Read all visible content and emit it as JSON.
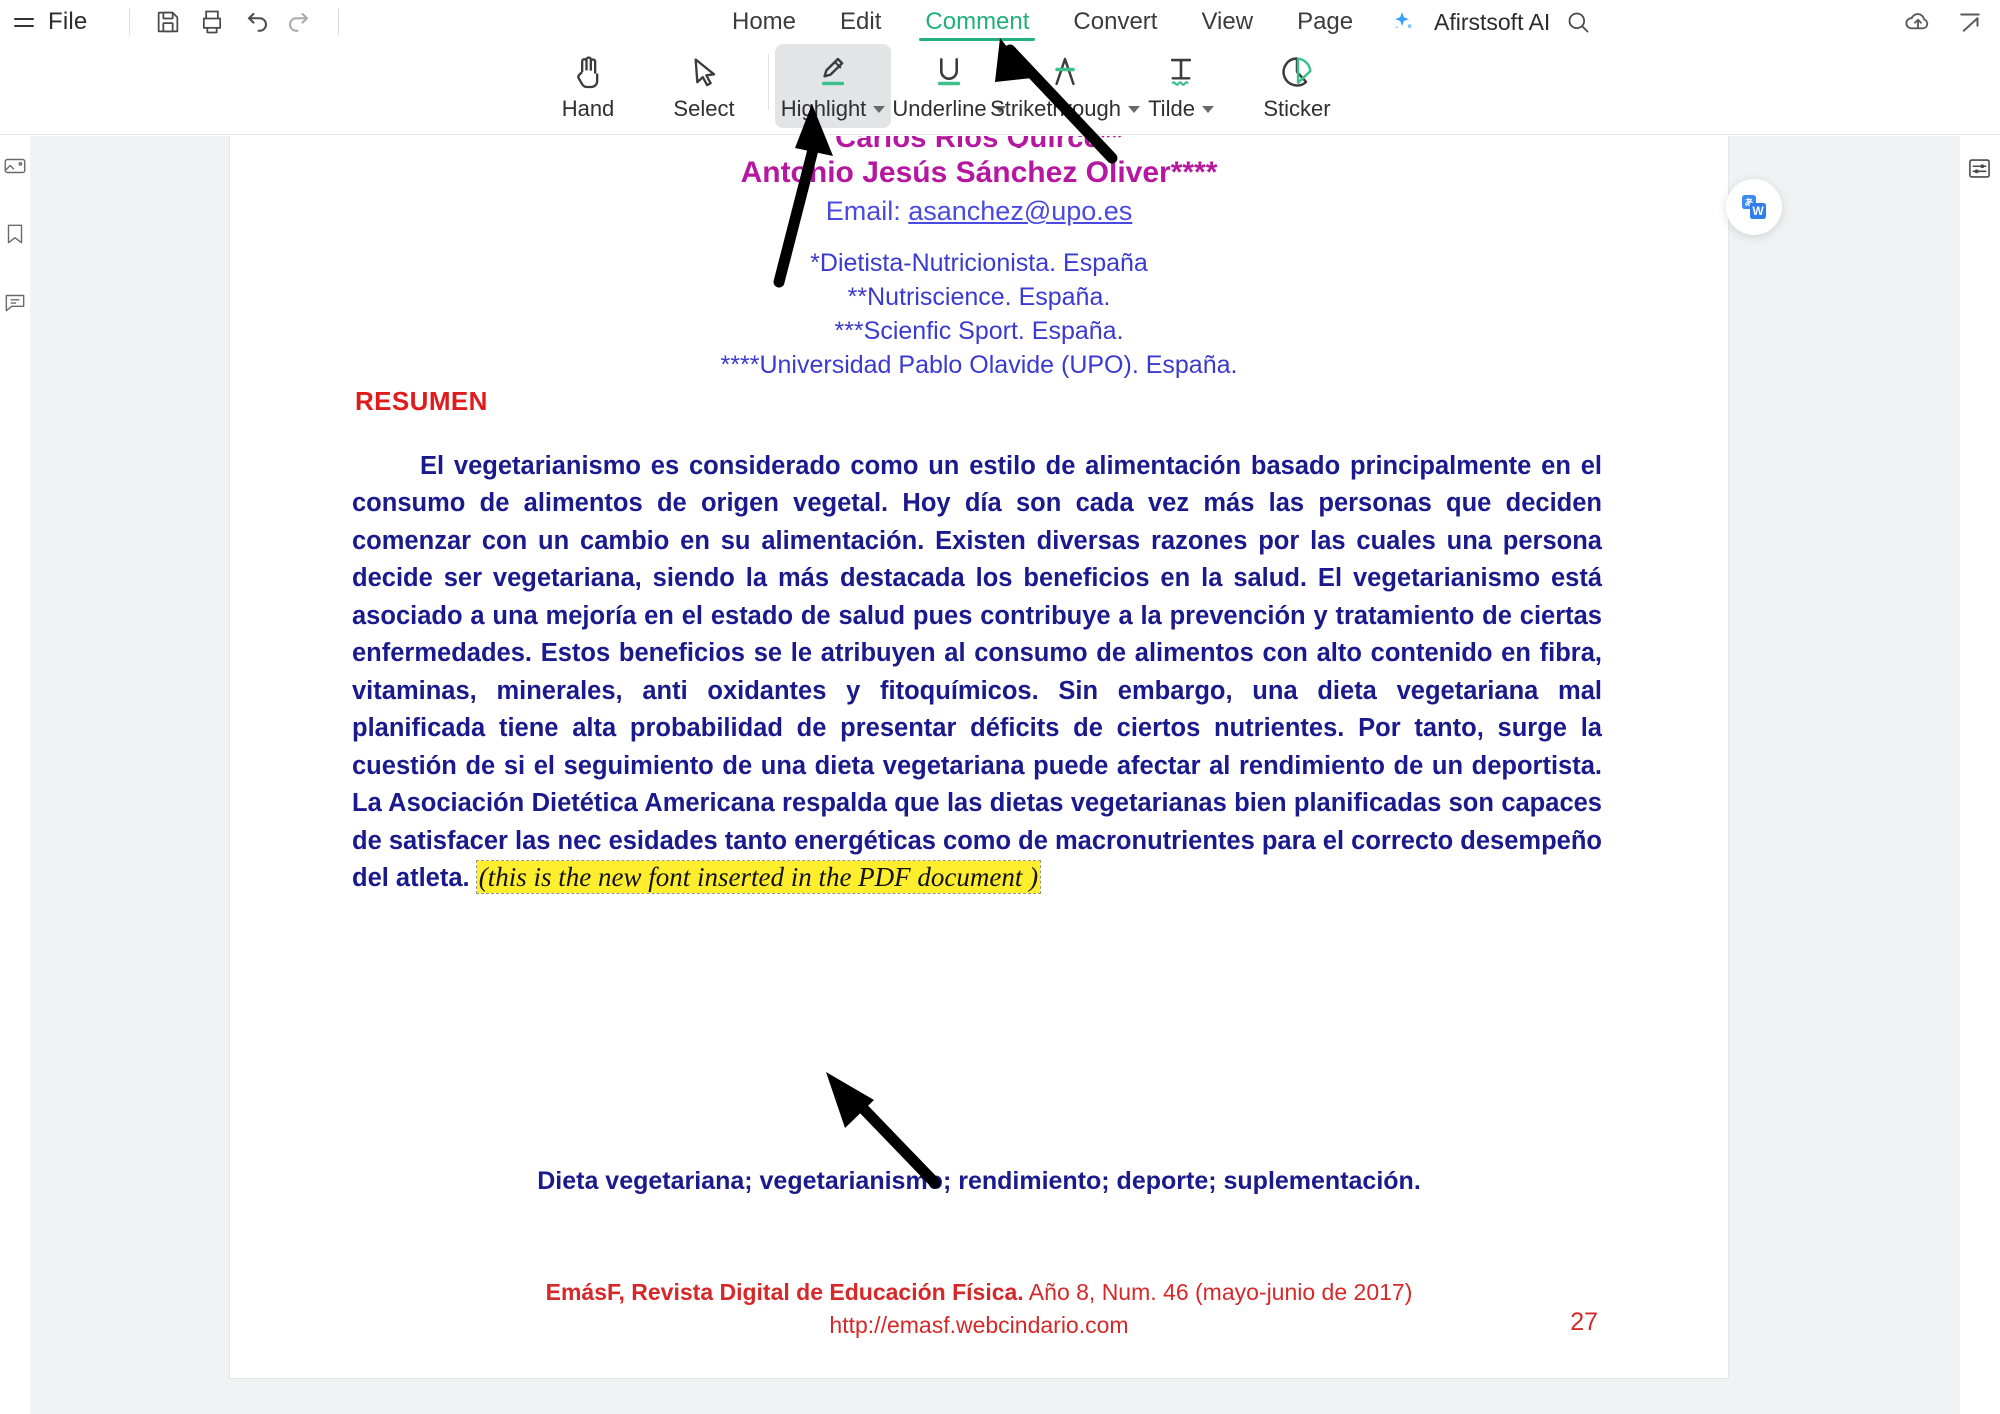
{
  "app": {
    "menu": {
      "file_label": "File",
      "hamburger_icon": "hamburger-menu-icon",
      "save_icon": "save-icon",
      "print_icon": "print-icon",
      "undo_icon": "undo-icon",
      "redo_icon": "redo-icon",
      "tabs": [
        {
          "label": "Home",
          "active": false
        },
        {
          "label": "Edit",
          "active": false
        },
        {
          "label": "Comment",
          "active": true
        },
        {
          "label": "Convert",
          "active": false
        },
        {
          "label": "View",
          "active": false
        },
        {
          "label": "Page",
          "active": false
        }
      ],
      "ai_label": "Afirstsoft AI",
      "ai_icon": "sparkle-icon",
      "search_icon": "search-icon",
      "cloud_icon": "cloud-upload-icon",
      "share_icon": "share-icon",
      "active_tab_color": "#22b07d"
    },
    "ribbon": {
      "tools": [
        {
          "label": "Hand",
          "icon": "hand-icon",
          "caret": false,
          "selected": false
        },
        {
          "label": "Select",
          "icon": "cursor-arrow-icon",
          "caret": false,
          "selected": false
        },
        {
          "label": "Highlight",
          "icon": "highlighter-icon",
          "caret": true,
          "selected": true
        },
        {
          "label": "Underline",
          "icon": "underline-icon",
          "caret": true,
          "selected": false
        },
        {
          "label": "Strikethrough",
          "icon": "strikethrough-icon",
          "caret": true,
          "selected": false
        },
        {
          "label": "Tilde",
          "icon": "tilde-icon",
          "caret": true,
          "selected": false
        },
        {
          "label": "Sticker",
          "icon": "sticker-icon",
          "caret": false,
          "selected": false
        }
      ]
    },
    "left_rail": [
      {
        "icon": "thumbnails-icon"
      },
      {
        "icon": "bookmark-icon"
      },
      {
        "icon": "comments-panel-icon"
      }
    ],
    "right_rail": [
      {
        "icon": "properties-sliders-icon"
      }
    ],
    "floating_button": {
      "icon": "word-translate-icon"
    }
  },
  "document": {
    "author_cut": "Carlos Rios Quirce**",
    "author_2": "Antonio Jesús Sánchez Oliver****",
    "email_prefix": "Email: ",
    "email": "asanchez@upo.es",
    "affiliations": [
      "*Dietista-Nutricionista. España",
      "**Nutriscience. España.",
      "***Scienfic Sport. España.",
      "****Universidad Pablo Olavide (UPO). España."
    ],
    "resumen_heading": "RESUMEN",
    "abstract_text": "El vegetarianismo es considerado como un estilo de alimentación basado principalmente en el consumo de alimentos de origen vegetal. Hoy día son cada vez más las personas que deciden comenzar con un cambio en su alimentación. Existen diversas razones por las cuales una persona decide ser vegetariana,  siendo la más destacada los beneficios en la salud. El vegetarianismo está  asociado a  una mejoría en el estado de salud pues contribuye a la prevención  y  tratamiento de ciertas enfermedades. Estos beneficios se le atribuyen al  consumo  de alimentos con alto  contenido  en  fibra,  vitaminas,  minerales, anti oxidantes y fitoquímicos.  Sin embargo,  una  dieta  vegetariana  mal planificada tiene  alta probabilidad  de presentar  déficits  de  ciertos  nutrientes. Por  tanto, surge  la cuestión  de  si  el seguimiento  de  una  dieta  vegetariana puede afectar  al rendimiento  de  un deportista. La Asociación Dietética  Americana  respalda que  las dietas vegetarianas bien  planificadas  son  capaces de  satisfacer   las  nec esidades  tanto  energéticas como de macronutrientes para el  correcto  desempeño del atleta. ",
    "inserted_annotation": "(this is the new  font inserted in   the  PDF document   )",
    "keywords": "Dieta vegetariana; vegetarianismo; rendimiento; deporte; suplementación.",
    "footer_bold": "EmásF, Revista Digital de Educación Física.",
    "footer_rest": " Año 8, Num. 46 (mayo-junio de 2017)",
    "footer_url": "http://emasf.webcindario.com",
    "page_number": "27",
    "colors": {
      "author": "#b5179e",
      "body": "#1a1a8c",
      "heading": "#e01b1b",
      "footer": "#d62828",
      "highlight": "#ffee2e",
      "link": "#4a4ae0"
    }
  }
}
